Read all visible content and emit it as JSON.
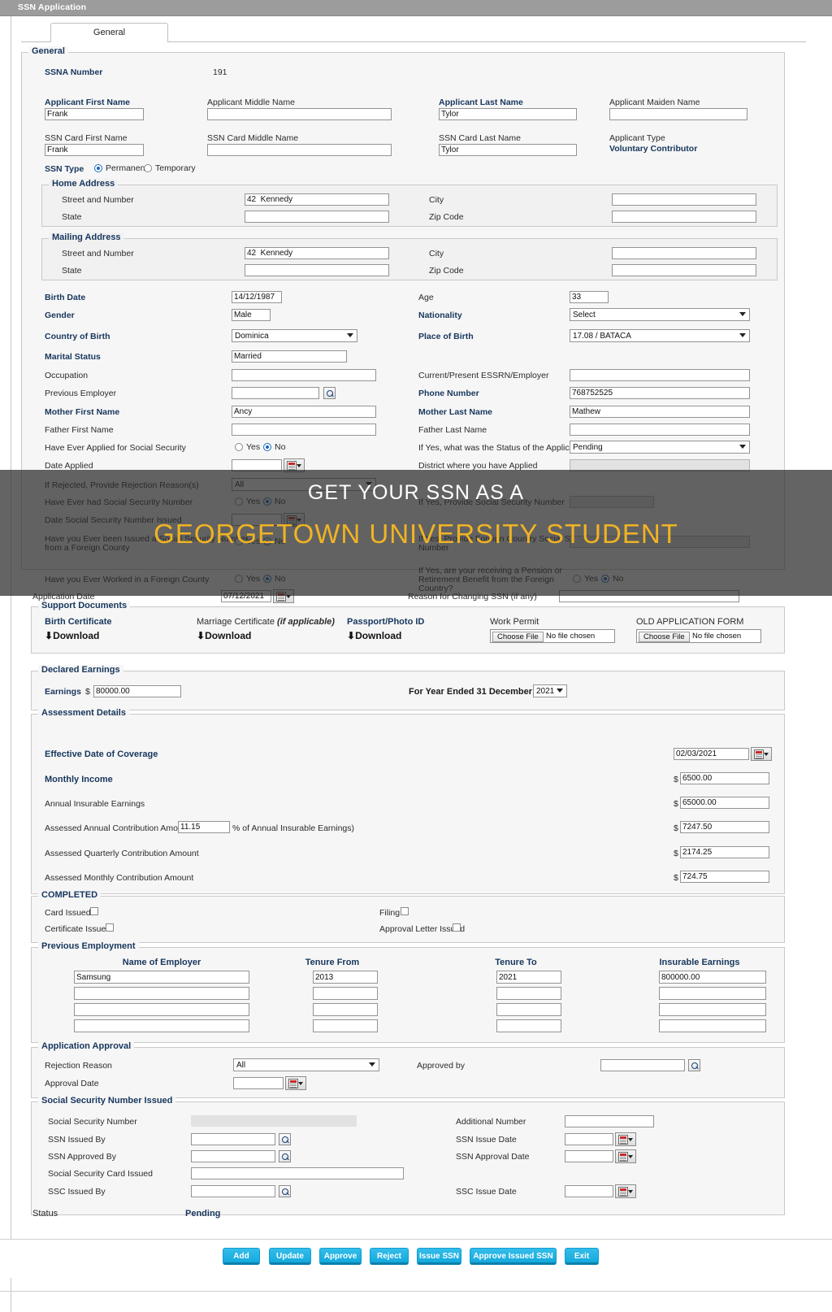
{
  "window": {
    "title": "SSN Application"
  },
  "tabs": [
    {
      "label": "General"
    }
  ],
  "general": {
    "legend": "General",
    "ssna_number_label": "SSNA Number",
    "ssna_number_value": "191",
    "applicant_first_name_label": "Applicant First Name",
    "applicant_first_name_value": "Frank",
    "applicant_middle_name_label": "Applicant Middle Name",
    "applicant_middle_name_value": "",
    "applicant_last_name_label": "Applicant Last Name",
    "applicant_last_name_value": "Tylor",
    "applicant_maiden_name_label": "Applicant Maiden Name",
    "applicant_maiden_name_value": "",
    "ssn_card_first_name_label": "SSN Card First Name",
    "ssn_card_first_name_value": "Frank",
    "ssn_card_middle_name_label": "SSN Card Middle Name",
    "ssn_card_middle_name_value": "",
    "ssn_card_last_name_label": "SSN Card Last Name",
    "ssn_card_last_name_value": "Tylor",
    "applicant_type_label": "Applicant Type",
    "applicant_type_value": "Voluntary Contributor",
    "ssn_type_label": "SSN Type",
    "ssn_type_permanent": "Permanent",
    "ssn_type_temporary": "Temporary",
    "ssn_type_selected": "Permanent"
  },
  "home_address": {
    "legend": "Home Address",
    "street_label": "Street and Number",
    "street_value": "42  Kennedy",
    "city_label": "City",
    "city_value": "",
    "state_label": "State",
    "state_value": "",
    "zip_label": "Zip Code",
    "zip_value": ""
  },
  "mailing_address": {
    "legend": "Mailing Address",
    "street_label": "Street and Number",
    "street_value": "42  Kennedy",
    "city_label": "City",
    "city_value": "",
    "state_label": "State",
    "state_value": "",
    "zip_label": "Zip Code",
    "zip_value": ""
  },
  "personal": {
    "birth_date_label": "Birth Date",
    "birth_date_value": "14/12/1987",
    "age_label": "Age",
    "age_value": "33",
    "gender_label": "Gender",
    "gender_value": "Male",
    "nationality_label": "Nationality",
    "nationality_value": "Select",
    "country_of_birth_label": "Country of Birth",
    "country_of_birth_value": "Dominica",
    "place_of_birth_label": "Place of Birth",
    "place_of_birth_value": "17.08 / BATACA",
    "marital_status_label": "Marital Status",
    "marital_status_value": "Married",
    "occupation_label": "Occupation",
    "occupation_value": "",
    "current_employer_label": "Current/Present ESSRN/Employer",
    "current_employer_value": "",
    "previous_employer_label": "Previous Employer",
    "previous_employer_value": "",
    "phone_number_label": "Phone Number",
    "phone_number_value": "768752525",
    "mother_first_name_label": "Mother First Name",
    "mother_first_name_value": "Ancy",
    "mother_last_name_label": "Mother Last Name",
    "mother_last_name_value": "Mathew",
    "father_first_name_label": "Father First Name",
    "father_first_name_value": "",
    "father_last_name_label": "Father Last Name",
    "father_last_name_value": ""
  },
  "history": {
    "ever_applied_label": "Have Ever Applied for Social Security",
    "ever_applied_yes": "Yes",
    "ever_applied_no": "No",
    "ever_applied_selected": "No",
    "status_of_application_label": "If Yes, what was the Status of the Application",
    "status_of_application_value": "Pending",
    "date_applied_label": "Date Applied",
    "date_applied_value": "",
    "district_applied_label": "District where you have Applied",
    "district_applied_value": "",
    "rejection_reasons_label": "If Rejected, Provide Rejection Reason(s)",
    "rejection_reasons_value": "All",
    "ever_had_ssn_label": "Have Ever had Social Security Number",
    "ever_had_ssn_yes": "Yes",
    "ever_had_ssn_no": "No",
    "ever_had_ssn_selected": "No",
    "provide_ssn_label": "If Yes, Provide Social Security Number",
    "provide_ssn_value": "",
    "date_ssn_issued_label": "Date Social Security Number Issued",
    "date_ssn_issued_value": "",
    "foreign_issued_label_1": "Have you Ever been Issued a Social Security Number",
    "foreign_issued_label_2": "from a Foreign County",
    "foreign_issued_yes": "Yes",
    "foreign_issued_no": "No",
    "foreign_issued_selected": "No",
    "foreign_ssn_label_1": "If Yes, Provide Foreign Country Social Security",
    "foreign_ssn_label_2": "Number",
    "foreign_ssn_value": "",
    "worked_foreign_label": "Have you Ever Worked in a Foreign County",
    "worked_foreign_yes": "Yes",
    "worked_foreign_no": "No",
    "worked_foreign_selected": "No",
    "pension_label_1": "If Yes, are your receiving a Pension or",
    "pension_label_2": "Retirement Benefit from the Foreign",
    "pension_label_3": "Country?",
    "pension_yes": "Yes",
    "pension_no": "No",
    "pension_selected": "No",
    "application_date_label": "Application Date",
    "application_date_value": "07/12/2021",
    "reason_change_ssn_label": "Reason for Changing SSN (if any)",
    "reason_change_ssn_value": ""
  },
  "support_documents": {
    "legend": "Support Documents",
    "items": [
      {
        "title": "Birth Certificate",
        "kind": "download",
        "action": "Download",
        "icon": "download-icon"
      },
      {
        "title": "Marriage Certificate ",
        "title_italic": "(if applicable)",
        "kind": "download",
        "action": "Download",
        "icon": "download-icon"
      },
      {
        "title": "Passport/Photo ID",
        "kind": "download",
        "action": "Download",
        "icon": "download-icon"
      },
      {
        "title": "Work Permit",
        "kind": "file",
        "button": "Choose File",
        "filename": "No file chosen"
      },
      {
        "title": "OLD APPLICATION FORM",
        "kind": "file",
        "button": "Choose File",
        "filename": "No file chosen"
      }
    ]
  },
  "declared_earnings": {
    "legend": "Declared Earnings",
    "earnings_label": "Earnings",
    "currency": "$",
    "earnings_value": "80000.00",
    "year_label": "For Year Ended 31 December",
    "year_value": "2021"
  },
  "assessment": {
    "legend": "Assessment Details",
    "effective_date_label": "Effective Date of Coverage",
    "effective_date_value": "02/03/2021",
    "monthly_income_label": "Monthly Income",
    "monthly_income_value": "6500.00",
    "annual_insurable_label": "Annual Insurable Earnings",
    "annual_insurable_value": "65000.00",
    "assessed_annual_label_a": "Assessed Annual Contribution Amount (",
    "assessed_annual_rate": "11.15",
    "assessed_annual_label_b": "% of Annual Insurable Earnings)",
    "assessed_annual_value": "7247.50",
    "assessed_quarterly_label": "Assessed Quarterly Contribution Amount",
    "assessed_quarterly_value": "2174.25",
    "assessed_monthly_label": "Assessed Monthly Contribution Amount",
    "assessed_monthly_value": "724.75",
    "currency": "$"
  },
  "completed": {
    "legend": "COMPLETED",
    "card_issued_label": "Card Issued",
    "filing_label": "Filing",
    "certificate_issued_label": "Certificate Issued",
    "approval_letter_label": "Approval Letter Issued"
  },
  "previous_employment": {
    "legend": "Previous Employment",
    "columns": [
      "Name of Employer",
      "Tenure From",
      "Tenure To",
      "Insurable Earnings"
    ],
    "rows": [
      {
        "employer": "Samsung",
        "from": "2013",
        "to": "2021",
        "earnings": "800000.00"
      },
      {
        "employer": "",
        "from": "",
        "to": "",
        "earnings": ""
      },
      {
        "employer": "",
        "from": "",
        "to": "",
        "earnings": ""
      },
      {
        "employer": "",
        "from": "",
        "to": "",
        "earnings": ""
      }
    ]
  },
  "application_approval": {
    "legend": "Application Approval",
    "rejection_reason_label": "Rejection Reason",
    "rejection_reason_value": "All",
    "approved_by_label": "Approved by",
    "approved_by_value": "",
    "approval_date_label": "Approval Date",
    "approval_date_value": ""
  },
  "ssn_issued": {
    "legend": "Social Security Number Issued",
    "ssn_label": "Social Security Number",
    "ssn_value": "",
    "additional_number_label": "Additional Number",
    "additional_number_value": "",
    "ssn_issued_by_label": "SSN Issued By",
    "ssn_issued_by_value": "",
    "ssn_issue_date_label": "SSN Issue Date",
    "ssn_issue_date_value": "",
    "ssn_approved_by_label": "SSN Approved By",
    "ssn_approved_by_value": "",
    "ssn_approval_date_label": "SSN Approval Date",
    "ssn_approval_date_value": "",
    "ssc_issued_label": "Social Security Card Issued",
    "ssc_issued_value": "",
    "ssc_issued_by_label": "SSC Issued By",
    "ssc_issued_by_value": "",
    "ssc_issue_date_label": "SSC Issue Date",
    "ssc_issue_date_value": ""
  },
  "status": {
    "label": "Status",
    "value": "Pending"
  },
  "actions": [
    {
      "label": "Add"
    },
    {
      "label": "Update"
    },
    {
      "label": "Approve"
    },
    {
      "label": "Reject"
    },
    {
      "label": "Issue SSN"
    },
    {
      "label": "Approve Issued SSN"
    },
    {
      "label": "Exit"
    }
  ],
  "overlay": {
    "line1": "GET YOUR SSN AS A",
    "line2": "GEORGETOWN UNIVERSITY STUDENT",
    "line1_color": "#ffffff",
    "line2_color": "#f0b323",
    "scrim_color": "rgba(40,40,40,0.72)"
  }
}
